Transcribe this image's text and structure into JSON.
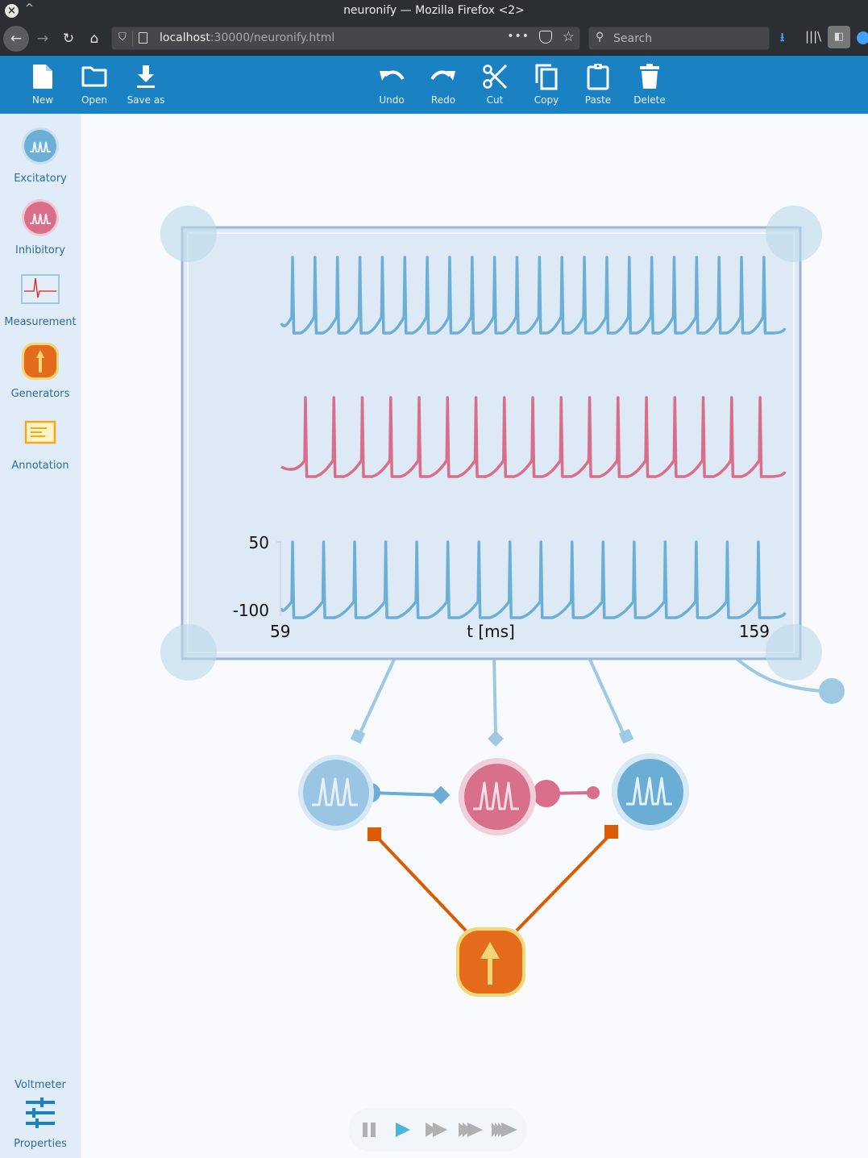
{
  "browser": {
    "window_title": "neuronify — Mozilla Firefox <2>",
    "url_host": "localhost",
    "url_rest": ":30000/neuronify.html",
    "search_placeholder": "Search",
    "nav_icons": [
      "back-icon",
      "forward-icon",
      "reload-icon",
      "home-icon"
    ],
    "toolbar_icons": [
      "download-icon",
      "library-icon",
      "sidebar-icon",
      "extension-icon"
    ]
  },
  "toolbar": {
    "left": [
      {
        "id": "new",
        "label": "New",
        "icon": "file-icon"
      },
      {
        "id": "open",
        "label": "Open",
        "icon": "folder-icon"
      },
      {
        "id": "save-as",
        "label": "Save as",
        "icon": "download-icon"
      }
    ],
    "center": [
      {
        "id": "undo",
        "label": "Undo",
        "icon": "undo-icon"
      },
      {
        "id": "redo",
        "label": "Redo",
        "icon": "redo-icon"
      },
      {
        "id": "cut",
        "label": "Cut",
        "icon": "scissors-icon"
      },
      {
        "id": "copy",
        "label": "Copy",
        "icon": "copy-icon"
      },
      {
        "id": "paste",
        "label": "Paste",
        "icon": "clipboard-icon"
      },
      {
        "id": "delete",
        "label": "Delete",
        "icon": "trash-icon"
      }
    ]
  },
  "palette": {
    "items": [
      {
        "id": "excitatory",
        "label": "Excitatory",
        "icon": "excitatory-neuron-icon"
      },
      {
        "id": "inhibitory",
        "label": "Inhibitory",
        "icon": "inhibitory-neuron-icon"
      },
      {
        "id": "measurement",
        "label": "Measurement",
        "icon": "measurement-icon"
      },
      {
        "id": "generators",
        "label": "Generators",
        "icon": "generator-icon"
      },
      {
        "id": "annotation",
        "label": "Annotation",
        "icon": "annotation-icon"
      }
    ],
    "selected_item_label": "Voltmeter",
    "properties_label": "Properties"
  },
  "voltmeter": {
    "y_max_label": "50",
    "y_min_label": "-100",
    "x_min_label": "59",
    "x_max_label": "159",
    "x_axis_label": "t [ms]",
    "traces": [
      {
        "name": "excitatory-neuron-1",
        "color": "#6baed6",
        "spike_count": 22
      },
      {
        "name": "inhibitory-neuron",
        "color": "#d86e8a",
        "spike_count": 17
      },
      {
        "name": "excitatory-neuron-2",
        "color": "#6baed6",
        "spike_count": 16
      }
    ]
  },
  "network": {
    "neurons": [
      {
        "id": "excitatory-left",
        "type": "excitatory",
        "color": "#9ac6e4"
      },
      {
        "id": "inhibitory-middle",
        "type": "inhibitory",
        "color": "#d8708c"
      },
      {
        "id": "excitatory-right",
        "type": "excitatory",
        "color": "#6aaed6"
      }
    ],
    "generator": {
      "id": "current-generator",
      "color": "#e46b1c"
    }
  },
  "playback": {
    "controls": [
      {
        "id": "pause",
        "icon": "pause-icon",
        "active": false
      },
      {
        "id": "play",
        "icon": "play-icon",
        "active": true
      },
      {
        "id": "fast",
        "icon": "fast-forward-icon",
        "active": false
      },
      {
        "id": "faster",
        "icon": "faster-forward-icon",
        "active": false
      },
      {
        "id": "fastest",
        "icon": "fastest-forward-icon",
        "active": false
      }
    ]
  },
  "colors": {
    "toolbar_bg": "#1a81c3",
    "palette_bg": "#e0ecf7",
    "palette_text": "#2f6c98",
    "excitatory": "#6baed6",
    "inhibitory": "#d86e8a",
    "generator": "#e46b1c",
    "generator_border": "#f3d676",
    "play_active": "#4ab7d9",
    "play_inactive": "#b0b0b0"
  }
}
